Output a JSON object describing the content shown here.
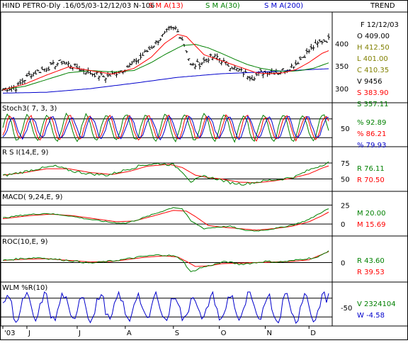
{
  "header": {
    "title": "HIND PETRO-Dly .16/05/03-12/12/03  N-106",
    "sma13": "S M A(13)",
    "sma30": "S M A(30)",
    "sma200": "S M A(200)",
    "trend": "TREND"
  },
  "colors": {
    "price": "#000000",
    "sma13": "#ff0000",
    "sma30": "#008000",
    "sma200": "#0000cc",
    "pct_d": "#0000cc",
    "wlm": "#0000cc"
  },
  "chart_data": [
    {
      "type": "ohlc",
      "panel": "price",
      "title": "HIND PETRO-Dly .16/05/03-12/12/03  N-106",
      "ylim": [
        275,
        460
      ],
      "yticks": [
        300,
        350,
        400
      ],
      "x_labels": [
        "'03",
        "J",
        "J",
        "A",
        "S",
        "O",
        "N",
        "D"
      ],
      "x_label_positions": [
        0,
        11,
        34,
        56,
        78,
        99,
        120,
        140
      ],
      "n_points": 150,
      "close_anchors": [
        [
          0,
          300
        ],
        [
          6,
          302
        ],
        [
          12,
          330
        ],
        [
          20,
          345
        ],
        [
          27,
          360
        ],
        [
          33,
          348
        ],
        [
          40,
          335
        ],
        [
          47,
          325
        ],
        [
          55,
          342
        ],
        [
          62,
          365
        ],
        [
          68,
          392
        ],
        [
          72,
          412
        ],
        [
          76,
          430
        ],
        [
          79,
          433
        ],
        [
          82,
          410
        ],
        [
          84,
          385
        ],
        [
          86,
          350
        ],
        [
          90,
          355
        ],
        [
          94,
          368
        ],
        [
          98,
          370
        ],
        [
          102,
          355
        ],
        [
          106,
          345
        ],
        [
          110,
          335
        ],
        [
          114,
          325
        ],
        [
          118,
          335
        ],
        [
          122,
          338
        ],
        [
          126,
          336
        ],
        [
          130,
          345
        ],
        [
          134,
          355
        ],
        [
          138,
          375
        ],
        [
          142,
          392
        ],
        [
          146,
          405
        ],
        [
          149,
          409
        ]
      ],
      "sma13_anchors": [
        [
          0,
          297
        ],
        [
          10,
          310
        ],
        [
          20,
          330
        ],
        [
          30,
          348
        ],
        [
          40,
          340
        ],
        [
          50,
          332
        ],
        [
          60,
          345
        ],
        [
          68,
          370
        ],
        [
          74,
          400
        ],
        [
          80,
          420
        ],
        [
          84,
          415
        ],
        [
          88,
          395
        ],
        [
          92,
          375
        ],
        [
          98,
          365
        ],
        [
          104,
          355
        ],
        [
          110,
          345
        ],
        [
          116,
          335
        ],
        [
          122,
          333
        ],
        [
          128,
          335
        ],
        [
          134,
          342
        ],
        [
          140,
          358
        ],
        [
          146,
          378
        ],
        [
          149,
          384
        ]
      ],
      "sma30_anchors": [
        [
          0,
          298
        ],
        [
          10,
          305
        ],
        [
          20,
          320
        ],
        [
          30,
          335
        ],
        [
          40,
          340
        ],
        [
          50,
          337
        ],
        [
          60,
          340
        ],
        [
          68,
          358
        ],
        [
          74,
          375
        ],
        [
          82,
          395
        ],
        [
          88,
          398
        ],
        [
          94,
          390
        ],
        [
          100,
          378
        ],
        [
          106,
          365
        ],
        [
          112,
          353
        ],
        [
          118,
          345
        ],
        [
          124,
          340
        ],
        [
          130,
          338
        ],
        [
          136,
          340
        ],
        [
          142,
          345
        ],
        [
          149,
          357
        ]
      ],
      "sma200_anchors": [
        [
          0,
          290
        ],
        [
          20,
          292
        ],
        [
          40,
          300
        ],
        [
          60,
          312
        ],
        [
          80,
          325
        ],
        [
          100,
          333
        ],
        [
          120,
          337
        ],
        [
          140,
          342
        ],
        [
          149,
          344
        ]
      ],
      "series": [
        {
          "name": "S M A(13)",
          "color": "#ff0000"
        },
        {
          "name": "S M A(30)",
          "color": "#008000"
        },
        {
          "name": "S M A(200)",
          "color": "#0000cc"
        }
      ],
      "legend": [
        {
          "label": "F 12/12/03",
          "color": "#000000"
        },
        {
          "label": "O    409.00",
          "color": "#000000"
        },
        {
          "label": "H    412.50",
          "color": "#808000"
        },
        {
          "label": "L    401.00",
          "color": "#808000"
        },
        {
          "label": "C    410.35",
          "color": "#808000"
        },
        {
          "label": "V    9456",
          "color": "#000000"
        },
        {
          "label": "S    383.90",
          "color": "#ff0000"
        },
        {
          "label": "S    357.11",
          "color": "#008000"
        }
      ]
    },
    {
      "type": "line",
      "panel": "stoch",
      "title": "Stoch3( 7, 3, 3)",
      "ylim": [
        0,
        100
      ],
      "yticks": [
        50
      ],
      "ref_lines": [
        20,
        80
      ],
      "series": [
        {
          "name": "%",
          "color": "#008000",
          "period": 9,
          "amp": 42,
          "mid": 52,
          "phase": 0
        },
        {
          "name": "%",
          "color": "#ff0000",
          "period": 9,
          "amp": 38,
          "mid": 52,
          "phase": -1.2
        },
        {
          "name": "%",
          "color": "#0000cc",
          "period": 9,
          "amp": 34,
          "mid": 52,
          "phase": -2.2
        }
      ],
      "legend": [
        {
          "label": "%    92.89",
          "color": "#008000"
        },
        {
          "label": "%    86.21",
          "color": "#ff0000"
        },
        {
          "label": "%    79.93",
          "color": "#0000cc"
        }
      ]
    },
    {
      "type": "line",
      "panel": "rsi",
      "title": "R S I(14,E, 9)",
      "ylim": [
        35,
        85
      ],
      "yticks": [
        50,
        75
      ],
      "ref_lines": [
        75,
        50
      ],
      "rsi_anchors": [
        [
          0,
          55
        ],
        [
          8,
          60
        ],
        [
          16,
          66
        ],
        [
          24,
          70
        ],
        [
          32,
          62
        ],
        [
          40,
          58
        ],
        [
          48,
          56
        ],
        [
          56,
          64
        ],
        [
          64,
          72
        ],
        [
          72,
          74
        ],
        [
          78,
          72
        ],
        [
          82,
          62
        ],
        [
          86,
          46
        ],
        [
          92,
          54
        ],
        [
          98,
          50
        ],
        [
          104,
          44
        ],
        [
          110,
          42
        ],
        [
          116,
          45
        ],
        [
          122,
          48
        ],
        [
          128,
          50
        ],
        [
          134,
          54
        ],
        [
          140,
          64
        ],
        [
          146,
          72
        ],
        [
          149,
          76
        ]
      ],
      "signal_anchors": [
        [
          0,
          56
        ],
        [
          10,
          60
        ],
        [
          20,
          66
        ],
        [
          30,
          66
        ],
        [
          40,
          60
        ],
        [
          50,
          57
        ],
        [
          58,
          62
        ],
        [
          66,
          70
        ],
        [
          76,
          73
        ],
        [
          82,
          68
        ],
        [
          88,
          56
        ],
        [
          94,
          52
        ],
        [
          100,
          50
        ],
        [
          108,
          45
        ],
        [
          116,
          44
        ],
        [
          124,
          47
        ],
        [
          132,
          51
        ],
        [
          140,
          58
        ],
        [
          146,
          67
        ],
        [
          149,
          70.5
        ]
      ],
      "series": [
        {
          "name": "R",
          "color": "#008000"
        },
        {
          "name": "R",
          "color": "#ff0000"
        }
      ],
      "legend": [
        {
          "label": "R    76.11",
          "color": "#008000"
        },
        {
          "label": "R    70.50",
          "color": "#ff0000"
        }
      ]
    },
    {
      "type": "line",
      "panel": "macd",
      "title": "MACD( 9,24,E, 9)",
      "ylim": [
        -12,
        30
      ],
      "yticks": [
        25,
        0
      ],
      "ref_lines": [
        25,
        0
      ],
      "macd_anchors": [
        [
          0,
          8
        ],
        [
          10,
          12
        ],
        [
          20,
          14
        ],
        [
          30,
          11
        ],
        [
          40,
          6
        ],
        [
          50,
          2
        ],
        [
          56,
          1
        ],
        [
          62,
          6
        ],
        [
          70,
          14
        ],
        [
          78,
          22
        ],
        [
          82,
          20
        ],
        [
          86,
          4
        ],
        [
          92,
          -6
        ],
        [
          98,
          -4
        ],
        [
          104,
          -3
        ],
        [
          110,
          -8
        ],
        [
          116,
          -9
        ],
        [
          122,
          -7
        ],
        [
          128,
          -4
        ],
        [
          134,
          0
        ],
        [
          140,
          6
        ],
        [
          146,
          16
        ],
        [
          149,
          20
        ]
      ],
      "signal_anchors": [
        [
          0,
          7
        ],
        [
          12,
          11
        ],
        [
          22,
          13
        ],
        [
          32,
          11
        ],
        [
          42,
          7
        ],
        [
          52,
          3
        ],
        [
          60,
          4
        ],
        [
          68,
          10
        ],
        [
          78,
          18
        ],
        [
          84,
          17
        ],
        [
          88,
          10
        ],
        [
          94,
          -2
        ],
        [
          100,
          -4
        ],
        [
          108,
          -6
        ],
        [
          116,
          -8
        ],
        [
          124,
          -6
        ],
        [
          132,
          -3
        ],
        [
          140,
          3
        ],
        [
          146,
          11
        ],
        [
          149,
          15.7
        ]
      ],
      "series": [
        {
          "name": "M",
          "color": "#008000"
        },
        {
          "name": "M",
          "color": "#ff0000"
        }
      ],
      "legend": [
        {
          "label": "M    20.00",
          "color": "#008000"
        },
        {
          "label": "M    15.69",
          "color": "#ff0000"
        }
      ]
    },
    {
      "type": "line",
      "panel": "roc",
      "title": "ROC(10,E, 9)",
      "ylim": [
        -60,
        60
      ],
      "yticks": [
        0
      ],
      "ref_lines": [
        0
      ],
      "roc_anchors": [
        [
          0,
          8
        ],
        [
          8,
          14
        ],
        [
          16,
          18
        ],
        [
          24,
          12
        ],
        [
          32,
          6
        ],
        [
          40,
          -2
        ],
        [
          48,
          4
        ],
        [
          56,
          12
        ],
        [
          64,
          22
        ],
        [
          72,
          28
        ],
        [
          78,
          24
        ],
        [
          82,
          10
        ],
        [
          86,
          -35
        ],
        [
          90,
          -20
        ],
        [
          96,
          -8
        ],
        [
          102,
          4
        ],
        [
          108,
          -6
        ],
        [
          114,
          -2
        ],
        [
          120,
          4
        ],
        [
          126,
          2
        ],
        [
          132,
          6
        ],
        [
          138,
          14
        ],
        [
          144,
          18
        ],
        [
          149,
          43.6
        ]
      ],
      "signal_anchors": [
        [
          0,
          8
        ],
        [
          10,
          12
        ],
        [
          20,
          14
        ],
        [
          30,
          8
        ],
        [
          40,
          2
        ],
        [
          50,
          4
        ],
        [
          58,
          12
        ],
        [
          66,
          20
        ],
        [
          74,
          24
        ],
        [
          80,
          20
        ],
        [
          84,
          4
        ],
        [
          88,
          -14
        ],
        [
          94,
          -12
        ],
        [
          100,
          -4
        ],
        [
          108,
          -2
        ],
        [
          116,
          0
        ],
        [
          124,
          2
        ],
        [
          132,
          4
        ],
        [
          140,
          10
        ],
        [
          149,
          39.5
        ]
      ],
      "series": [
        {
          "name": "R",
          "color": "#008000"
        },
        {
          "name": "R",
          "color": "#ff0000"
        }
      ],
      "legend": [
        {
          "label": "R    43.60",
          "color": "#008000"
        },
        {
          "label": "R    39.53",
          "color": "#ff0000"
        }
      ]
    },
    {
      "type": "line",
      "panel": "wlm",
      "title": "WLM %R(10)",
      "ylim": [
        -100,
        0
      ],
      "yticks": [
        -50
      ],
      "ref_lines": [
        -20,
        -80
      ],
      "series": [
        {
          "name": "WLM %R(10)",
          "color": "#0000cc"
        }
      ],
      "legend": [
        {
          "label": "V  2324104",
          "color": "#008000"
        },
        {
          "label": "W    -4.58",
          "color": "#0000cc"
        }
      ]
    }
  ]
}
